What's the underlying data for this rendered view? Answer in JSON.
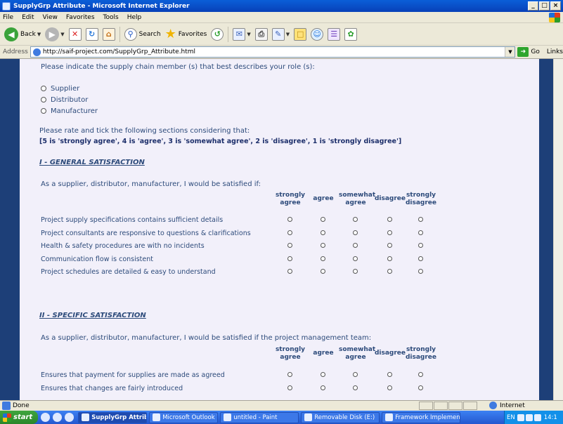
{
  "window": {
    "title": "SupplyGrp Attribute - Microsoft Internet Explorer",
    "controls": [
      "_",
      "×"
    ]
  },
  "menu": [
    "File",
    "Edit",
    "View",
    "Favorites",
    "Tools",
    "Help"
  ],
  "toolbar": {
    "back": "Back",
    "search": "Search",
    "favorites": "Favorites"
  },
  "address": {
    "label": "Address",
    "url": "http://saif-project.com/SupplyGrp_Attribute.html",
    "go": "Go",
    "links": "Links"
  },
  "form": {
    "role_question": "Please indicate the supply chain member (s) that best describes your role (s):",
    "roles": [
      "Supplier",
      "Distributor",
      "Manufacturer"
    ],
    "rating_intro": "Please rate and tick the following sections considering that:",
    "rating_scale": "[5 is 'strongly agree', 4 is 'agree', 3 is 'somewhat agree', 2 is 'disagree', 1 is 'strongly disagree']",
    "columns": [
      [
        "strongly",
        "agree"
      ],
      [
        "agree",
        ""
      ],
      [
        "somewhat",
        "agree"
      ],
      [
        "disagree",
        ""
      ],
      [
        "strongly",
        "disagree"
      ]
    ],
    "sections": [
      {
        "title": "I - GENERAL SATISFACTION",
        "intro": "As a supplier, distributor, manufacturer, I would be satisfied if:",
        "items": [
          "Project supply specifications contains sufficient details",
          "Project consultants are responsive to questions & clarifications",
          "Health & safety procedures are with no incidents",
          "Communication flow is consistent",
          "Project schedules are detailed & easy to understand"
        ]
      },
      {
        "title": "II - SPECIFIC SATISFACTION",
        "intro": "As a supplier, distributor, manufacturer, I would be satisfied if the project management team:",
        "items": [
          "Ensures that payment for supplies are made as agreed",
          "Ensures that changes are fairly introduced"
        ]
      }
    ]
  },
  "status": {
    "text": "Done",
    "zone": "Internet"
  },
  "taskbar": {
    "start": "start",
    "tasks": [
      "SupplyGrp Attribu...",
      "Microsoft Outlook W...",
      "untitled - Paint",
      "Removable Disk (E:)",
      "Framework Implemen..."
    ],
    "tray_lang": "EN",
    "clock": "14:1"
  }
}
